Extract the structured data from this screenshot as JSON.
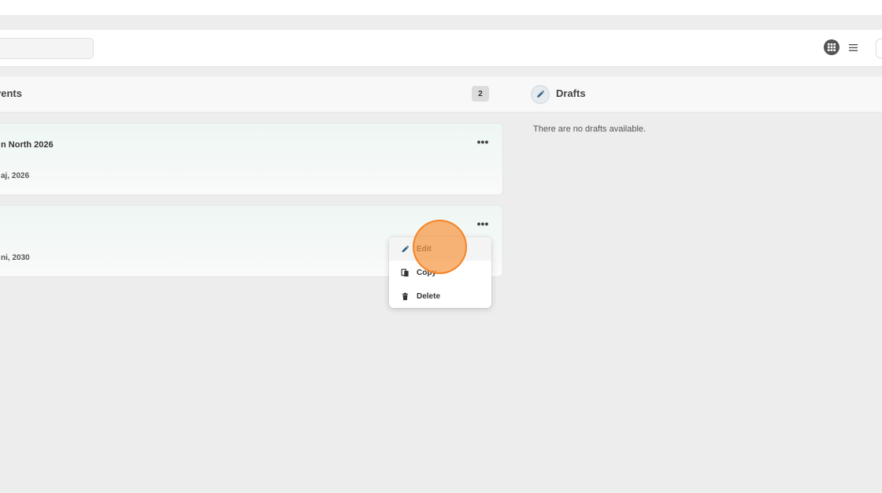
{
  "toolbar": {
    "search": {
      "placeholder": ""
    },
    "view_grid_icon": "grid-icon",
    "view_list_icon": "list-icon"
  },
  "panels": {
    "events": {
      "title": "vents",
      "count": "2",
      "items": [
        {
          "title": "n North 2026",
          "date": "aj, 2026"
        },
        {
          "title": "",
          "date": "ni, 2030"
        }
      ]
    },
    "drafts": {
      "title": "Drafts",
      "icon": "pencil-icon",
      "empty_message": "There are no drafts available."
    }
  },
  "context_menu": {
    "items": [
      {
        "label": "Edit",
        "icon": "pencil-icon"
      },
      {
        "label": "Copy",
        "icon": "copy-icon"
      },
      {
        "label": "Delete",
        "icon": "trash-icon"
      }
    ]
  },
  "colors": {
    "page_bg": "#ededed",
    "card_bg": "#eef7f4",
    "edit_icon": "#2f5b7c",
    "highlight": "#f79742"
  }
}
